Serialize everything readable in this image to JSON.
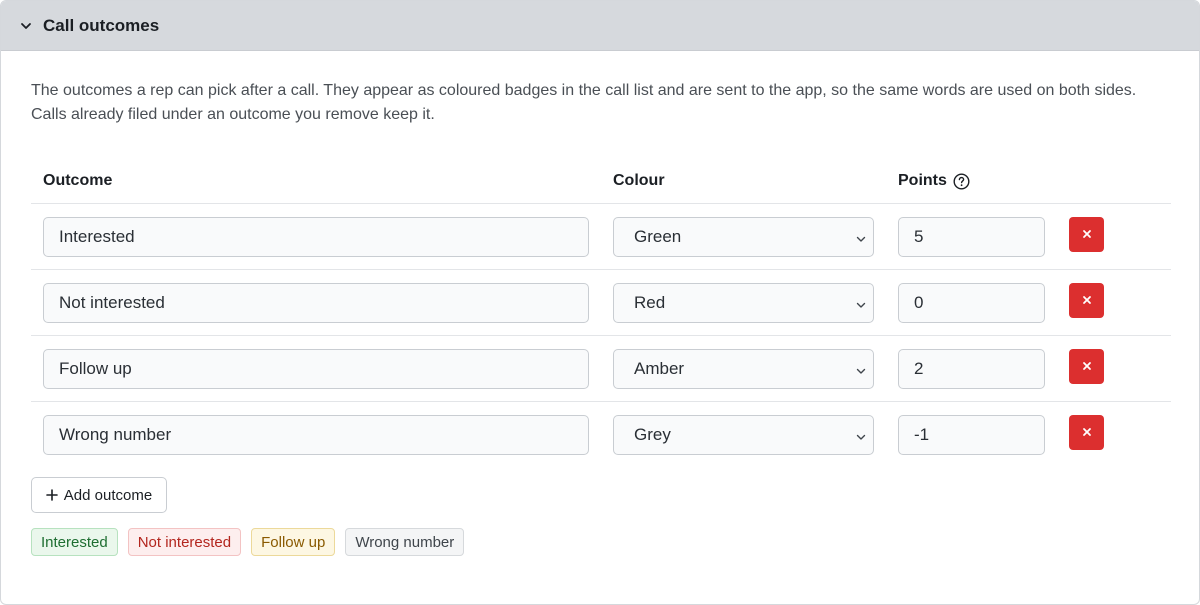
{
  "panel": {
    "title": "Call outcomes",
    "description": "The outcomes a rep can pick after a call. They appear as coloured badges in the call list and are sent to the app, so the same words are used on both sides. Calls already filed under an outcome you remove keep it."
  },
  "table": {
    "headers": {
      "outcome": "Outcome",
      "colour": "Colour",
      "points": "Points"
    },
    "rows": [
      {
        "outcome": "Interested",
        "colour": "Green",
        "points": "5"
      },
      {
        "outcome": "Not interested",
        "colour": "Red",
        "points": "0"
      },
      {
        "outcome": "Follow up",
        "colour": "Amber",
        "points": "2"
      },
      {
        "outcome": "Wrong number",
        "colour": "Grey",
        "points": "-1"
      }
    ]
  },
  "actions": {
    "add_label": "Add outcome"
  },
  "preview_badges": [
    {
      "label": "Interested",
      "color": "#1e6e31"
    },
    {
      "label": "Not interested",
      "color": "#b3261e"
    },
    {
      "label": "Follow up",
      "color": "#8a5a00"
    },
    {
      "label": "Wrong number",
      "color": "#3f454b"
    }
  ],
  "colors": {
    "delete_button": "#dc2f2f",
    "header_bg": "#d6d9dd"
  },
  "icons": {
    "collapse": "chevron-down-icon",
    "help": "help-icon",
    "delete": "close-icon",
    "add": "plus-icon"
  }
}
